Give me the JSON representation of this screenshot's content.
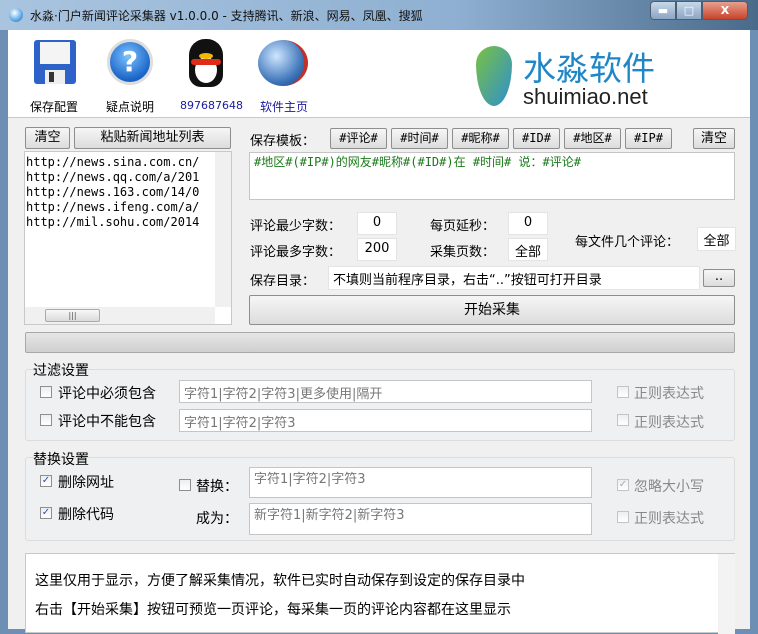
{
  "window": {
    "title": "水淼·门户新闻评论采集器 v1.0.0.0 - 支持腾讯、新浪、网易、凤凰、搜狐",
    "minimize": "▬",
    "maximize": "□",
    "close": "X"
  },
  "toolbar": {
    "save": "保存配置",
    "help": "疑点说明",
    "qq": "897687648",
    "home": "软件主页"
  },
  "logo": {
    "cn": "水淼软件",
    "en": "shuimiao.net"
  },
  "urls": {
    "clear": "清空",
    "paste": "粘贴新闻地址列表",
    "items": [
      "http://news.sina.com.cn/",
      "http://news.qq.com/a/201",
      "http://news.163.com/14/0",
      "http://news.ifeng.com/a/",
      "http://mil.sohu.com/2014"
    ]
  },
  "template": {
    "label": "保存模板：",
    "tags": [
      "#评论#",
      "#时间#",
      "#昵称#",
      "#ID#",
      "#地区#",
      "#IP#"
    ],
    "clear": "清空",
    "value": "#地区#(#IP#)的网友#昵称#(#ID#)在 #时间# 说：#评论#"
  },
  "settings": {
    "min_label": "评论最少字数：",
    "min": "0",
    "max_label": "评论最多字数：",
    "max": "200",
    "delay_label": "每页延秒：",
    "delay": "0",
    "pages_label": "采集页数：",
    "pages": "全部",
    "per_file_label": "每文件几个评论：",
    "per_file": "全部",
    "dir_label": "保存目录：",
    "dir_placeholder": "不填则当前程序目录，右击“..”按钮可打开目录",
    "browse": "..",
    "start": "开始采集"
  },
  "progress": 0,
  "filter": {
    "title": "过滤设置",
    "must_label": "评论中必须包含",
    "must_placeholder": "字符1|字符2|字符3|更多使用|隔开",
    "not_label": "评论中不能包含",
    "not_placeholder": "字符1|字符2|字符3",
    "regex": "正则表达式"
  },
  "replace": {
    "title": "替换设置",
    "del_url": "删除网址",
    "del_code": "删除代码",
    "replace_label": "替换：",
    "replace_placeholder": "字符1|字符2|字符3",
    "to_label": "成为：",
    "to_placeholder": "新字符1|新字符2|新字符3",
    "ignore_case": "忽略大小写",
    "regex": "正则表达式"
  },
  "log": {
    "lines": [
      "这里仅用于显示，方便了解采集情况，软件已实时自动保存到设定的保存目录中",
      "右击【开始采集】按钮可预览一页评论，每采集一页的评论内容都在这里显示"
    ]
  }
}
